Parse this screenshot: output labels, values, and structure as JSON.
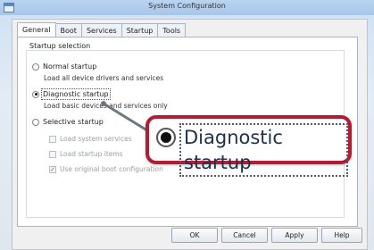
{
  "window": {
    "title": "System Configuration"
  },
  "tabs": [
    "General",
    "Boot",
    "Services",
    "Startup",
    "Tools"
  ],
  "startup_selection": {
    "label": "Startup selection",
    "normal": {
      "label": "Normal startup",
      "desc": "Load all device drivers and services"
    },
    "diagnostic": {
      "label": "Diagnostic startup",
      "desc": "Load basic devices and services only"
    },
    "selective": {
      "label": "Selective startup",
      "options": [
        {
          "label": "Load system services",
          "checked": false
        },
        {
          "label": "Load startup items",
          "checked": false
        },
        {
          "label": "Use original boot configuration",
          "checked": true
        }
      ]
    }
  },
  "buttons": {
    "ok": "OK",
    "cancel": "Cancel",
    "apply": "Apply",
    "help": "Help"
  },
  "callout": {
    "text": "Diagnostic startup"
  },
  "colors": {
    "callout_border": "#b11c36"
  }
}
